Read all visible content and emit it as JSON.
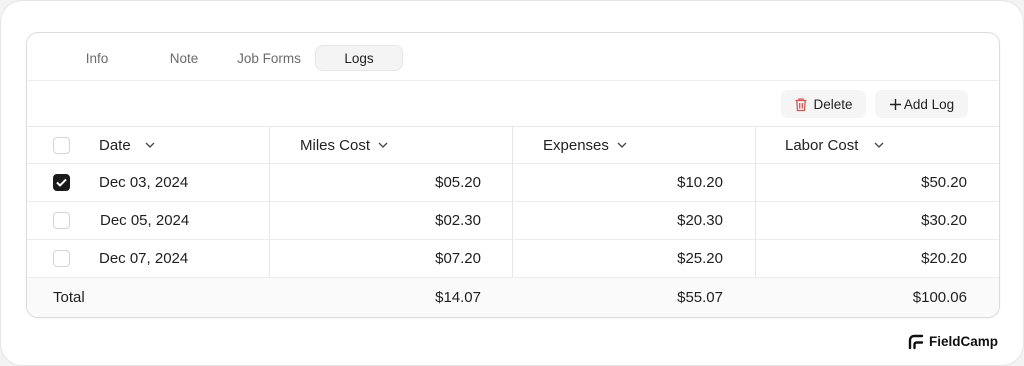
{
  "tabs": [
    {
      "label": "Info",
      "active": false
    },
    {
      "label": "Note",
      "active": false
    },
    {
      "label": "Job Forms",
      "active": false
    },
    {
      "label": "Logs",
      "active": true
    }
  ],
  "toolbar": {
    "delete_label": "Delete",
    "add_log_label": "Add Log",
    "delete_icon": "trash-icon",
    "add_icon": "plus-icon",
    "delete_icon_color": "#d9534f"
  },
  "table": {
    "columns": [
      {
        "label": "Date",
        "icon": "chevron-down-icon"
      },
      {
        "label": "Miles Cost",
        "icon": "chevron-down-icon"
      },
      {
        "label": "Expenses",
        "icon": "chevron-down-icon"
      },
      {
        "label": "Labor Cost",
        "icon": "chevron-down-icon"
      }
    ],
    "rows": [
      {
        "checked": true,
        "date": "Dec 03, 2024",
        "miles_cost": "$05.20",
        "expenses": "$10.20",
        "labor_cost": "$50.20"
      },
      {
        "checked": false,
        "date": "Dec 05, 2024",
        "miles_cost": "$02.30",
        "expenses": "$20.30",
        "labor_cost": "$30.20"
      },
      {
        "checked": false,
        "date": "Dec 07, 2024",
        "miles_cost": "$07.20",
        "expenses": "$25.20",
        "labor_cost": "$20.20"
      }
    ],
    "total": {
      "label": "Total",
      "miles_cost": "$14.07",
      "expenses": "$55.07",
      "labor_cost": "$100.06"
    }
  },
  "brand": {
    "name": "FieldCamp",
    "icon": "fieldcamp-logo-icon"
  }
}
